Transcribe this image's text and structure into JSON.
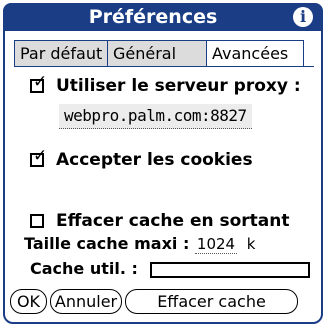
{
  "window": {
    "title": "Préférences",
    "info_icon": "info-icon"
  },
  "tabs": [
    {
      "label": "Par défaut",
      "active": false
    },
    {
      "label": "Général",
      "active": false
    },
    {
      "label": "Avancées",
      "active": true
    }
  ],
  "proxy": {
    "label": "Utiliser le serveur proxy :",
    "checked": true,
    "value": "webpro.palm.com:8827"
  },
  "cookies": {
    "label": "Accepter les cookies",
    "checked": true
  },
  "clear_cache": {
    "label": "Effacer cache en sortant",
    "checked": false
  },
  "cache_max": {
    "label": "Taille cache maxi :",
    "value": "1024",
    "unit": "k"
  },
  "cache_used": {
    "label": "Cache util. :",
    "fraction": 0
  },
  "buttons": {
    "ok": "OK",
    "cancel": "Annuler",
    "clear": "Effacer cache"
  },
  "colors": {
    "title_bar": "#1a3d86"
  }
}
